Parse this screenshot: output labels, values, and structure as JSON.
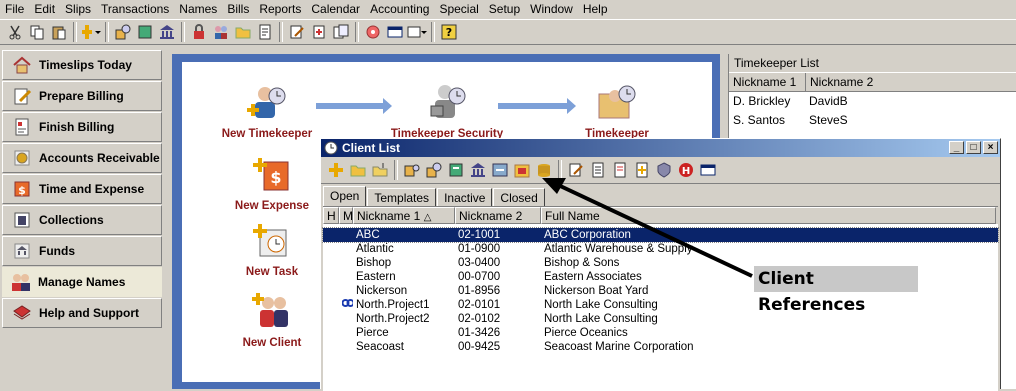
{
  "menu": [
    "File",
    "Edit",
    "Slips",
    "Transactions",
    "Names",
    "Bills",
    "Reports",
    "Calendar",
    "Accounting",
    "Special",
    "Setup",
    "Window",
    "Help"
  ],
  "sidebar": {
    "items": [
      {
        "label": "Timeslips Today",
        "icon": "house-icon"
      },
      {
        "label": "Prepare Billing",
        "icon": "pencil-paper-icon"
      },
      {
        "label": "Finish Billing",
        "icon": "invoice-icon"
      },
      {
        "label": "Accounts Receivable",
        "icon": "coins-icon"
      },
      {
        "label": "Time and Expense",
        "icon": "money-bag-icon"
      },
      {
        "label": "Collections",
        "icon": "building-icon"
      },
      {
        "label": "Funds",
        "icon": "bank-icon"
      },
      {
        "label": "Manage Names",
        "icon": "people-icon"
      },
      {
        "label": "Help and Support",
        "icon": "book-icon"
      }
    ],
    "active_index": 7
  },
  "flow": {
    "new_timekeeper": "New Timekeeper",
    "timekeeper_security": "Timekeeper Security",
    "timekeeper": "Timekeeper",
    "new_expense": "New Expense",
    "new_task": "New Task",
    "new_client": "New Client"
  },
  "timekeeper_list": {
    "title": "Timekeeper List",
    "columns": [
      "Nickname 1",
      "Nickname 2"
    ],
    "rows": [
      [
        "D. Brickley",
        "DavidB"
      ],
      [
        "S. Santos",
        "SteveS"
      ]
    ]
  },
  "client_list": {
    "title": "Client List",
    "window_buttons": [
      "_",
      "□",
      "×"
    ],
    "tabs": [
      "Open",
      "Templates",
      "Inactive",
      "Closed"
    ],
    "active_tab": 0,
    "columns": [
      "H",
      "M",
      "Nickname 1",
      "Nickname 2",
      "Full Name"
    ],
    "sort_indicator": "△",
    "rows": [
      {
        "nick1": "ABC",
        "nick2": "02-1001",
        "full": "ABC Corporation",
        "selected": true
      },
      {
        "nick1": "Atlantic",
        "nick2": "01-0900",
        "full": "Atlantic Warehouse & Supply"
      },
      {
        "nick1": "Bishop",
        "nick2": "03-0400",
        "full": "Bishop & Sons"
      },
      {
        "nick1": "Eastern",
        "nick2": "00-0700",
        "full": "Eastern Associates"
      },
      {
        "nick1": "Nickerson",
        "nick2": "01-8956",
        "full": "Nickerson Boat Yard"
      },
      {
        "nick1": "North.Project1",
        "nick2": "02-0101",
        "full": "North Lake Consulting",
        "linked": true
      },
      {
        "nick1": "North.Project2",
        "nick2": "02-0102",
        "full": "North Lake Consulting"
      },
      {
        "nick1": "Pierce",
        "nick2": "01-3426",
        "full": "Pierce Oceanics"
      },
      {
        "nick1": "Seacoast",
        "nick2": "00-9425",
        "full": "Seacoast Marine Corporation"
      }
    ]
  },
  "callout": {
    "label": "Client References"
  },
  "colors": {
    "accent": "#0a246a",
    "flow_text": "#8b1a1a",
    "panel_blue": "#4a6eb5"
  }
}
